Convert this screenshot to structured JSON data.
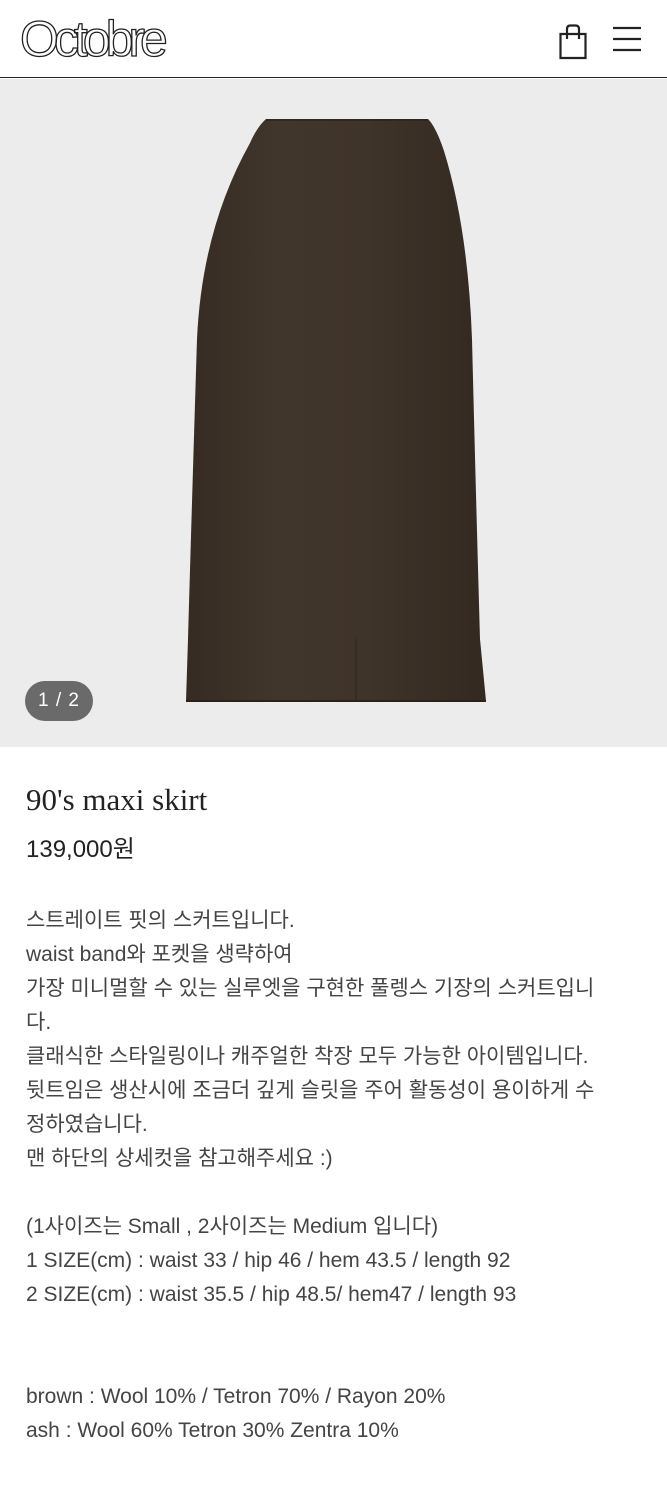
{
  "header": {
    "logo": "Octobre",
    "icons": [
      "shopping-bag-icon",
      "hamburger-menu-icon"
    ]
  },
  "gallery": {
    "counter": "1 / 2"
  },
  "product": {
    "name": "90's maxi skirt",
    "price": "139,000원",
    "description": [
      "스트레이트 핏의 스커트입니다.",
      "waist band와 포켓을 생략하여",
      "가장 미니멀할 수 있는 실루엣을 구현한 풀렝스 기장의 스커트입니",
      "다.",
      "클래식한 스타일링이나 캐주얼한 착장 모두 가능한 아이템입니다.",
      "뒷트임은 생산시에 조금더 깊게 슬릿을 주어 활동성이 용이하게 수",
      "정하였습니다.",
      "맨 하단의 상세컷을 참고해주세요 :)"
    ],
    "sizes": [
      "(1사이즈는 Small , 2사이즈는 Medium 입니다)",
      "1 SIZE(cm) : waist 33  / hip 46 / hem 43.5 / length 92",
      "2 SIZE(cm) : waist 35.5 / hip 48.5/ hem47 / length 93"
    ],
    "materials": [
      "brown : Wool 10% / Tetron 70% / Rayon 20%",
      "ash : Wool 60% Tetron 30% Zentra 10%"
    ]
  },
  "colors": {
    "skirt_brown": "#3e3329",
    "gallery_bg": "#ececec",
    "counter_bg": "#6a6a6a"
  }
}
